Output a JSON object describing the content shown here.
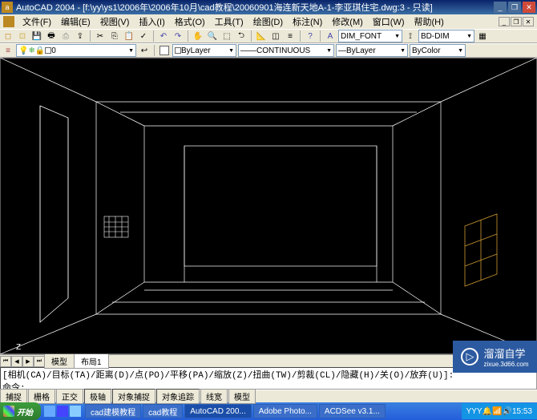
{
  "app": {
    "name": "AutoCAD 2004",
    "title_path": "[f:\\yy\\ys1\\2006年\\2006年10月\\cad教程\\20060901海连新天地A-1-李亚琪住宅.dwg:3 - 只读]"
  },
  "menu": {
    "file": "文件(F)",
    "edit": "编辑(E)",
    "view": "视图(V)",
    "insert": "插入(I)",
    "format": "格式(O)",
    "tools": "工具(T)",
    "draw": "绘图(D)",
    "dimension": "标注(N)",
    "modify": "修改(M)",
    "window": "窗口(W)",
    "help": "帮助(H)"
  },
  "properties": {
    "layer": "ByLayer",
    "linetype": "CONTINUOUS",
    "lineweight": "ByLayer",
    "color": "ByColor",
    "textstyle": "DIM_FONT",
    "dimstyle": "BD-DIM"
  },
  "tabs": {
    "model": "模型",
    "layout1": "布局1"
  },
  "command": {
    "line1": "[相机(CA)/目标(TA)/距离(D)/点(PO)/平移(PA)/缩放(Z)/扭曲(TW)/剪裁(CL)/隐藏(H)/关(O)/放弃(U)]:",
    "line2": "命令:"
  },
  "status": {
    "snap": "捕捉",
    "grid": "栅格",
    "ortho": "正交",
    "polar": "极轴",
    "osnap": "对象捕捉",
    "otrack": "对象追踪",
    "lwt": "线宽",
    "model": "模型"
  },
  "taskbar": {
    "start": "开始",
    "items": [
      "cad建模教程",
      "cad教程",
      "AutoCAD 200...",
      "Adobe Photo...",
      "ACDSee v3.1..."
    ],
    "tray_text": "YYY",
    "clock": "15:53"
  },
  "ucs": {
    "z": "Z"
  },
  "watermark": {
    "text": "溜溜自学",
    "url": "zixue.3d66.com"
  }
}
